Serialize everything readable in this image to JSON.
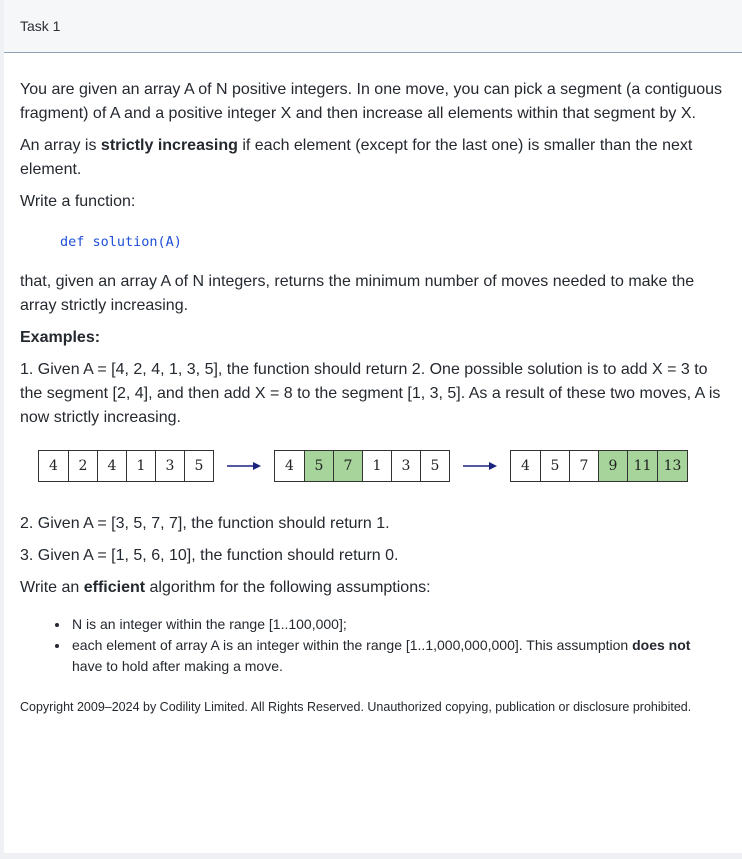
{
  "tab": {
    "title": "Task 1"
  },
  "task": {
    "intro_1": "You are given an array A of N positive integers. In one move, you can pick a segment (a contiguous fragment) of A and a positive integer X and then increase all elements within that segment by X.",
    "intro_2_a": "An array is ",
    "intro_2_bold": "strictly increasing",
    "intro_2_b": " if each element (except for the last one) is smaller than the next element.",
    "write_fn": "Write a function:",
    "code": "def solution(A)",
    "returns": "that, given an array A of N integers, returns the minimum number of moves needed to make the array strictly increasing.",
    "examples_heading": "Examples:",
    "example_1": "1. Given A = [4, 2, 4, 1, 3, 5], the function should return 2. One possible solution is to add X = 3 to the segment [2, 4], and then add X = 8 to the segment [1, 3, 5]. As a result of these two moves, A is now strictly increasing.",
    "example_2": "2. Given A = [3, 5, 7, 7], the function should return 1.",
    "example_3": "3. Given A = [1, 5, 6, 10], the function should return 0.",
    "efficient_a": "Write an ",
    "efficient_bold": "efficient",
    "efficient_b": " algorithm for the following assumptions:",
    "assumption_1": "N is an integer within the range [1..100,000];",
    "assumption_2_a": "each element of array A is an integer within the range [1..1,000,000,000]. This assumption ",
    "assumption_2_bold": "does not",
    "assumption_2_b": " have to hold after making a move.",
    "copyright": "Copyright 2009–2024 by Codility Limited. All Rights Reserved. Unauthorized copying, publication or disclosure prohibited."
  },
  "illustration": {
    "arrays": [
      {
        "cells": [
          "4",
          "2",
          "4",
          "1",
          "3",
          "5"
        ],
        "highlight": [
          false,
          false,
          false,
          false,
          false,
          false
        ]
      },
      {
        "cells": [
          "4",
          "5",
          "7",
          "1",
          "3",
          "5"
        ],
        "highlight": [
          false,
          true,
          true,
          false,
          false,
          false
        ]
      },
      {
        "cells": [
          "4",
          "5",
          "7",
          "9",
          "11",
          "13"
        ],
        "highlight": [
          false,
          false,
          false,
          true,
          true,
          true
        ]
      }
    ],
    "highlight_color": "#a6d49a",
    "arrow_color": "#1a237e"
  }
}
